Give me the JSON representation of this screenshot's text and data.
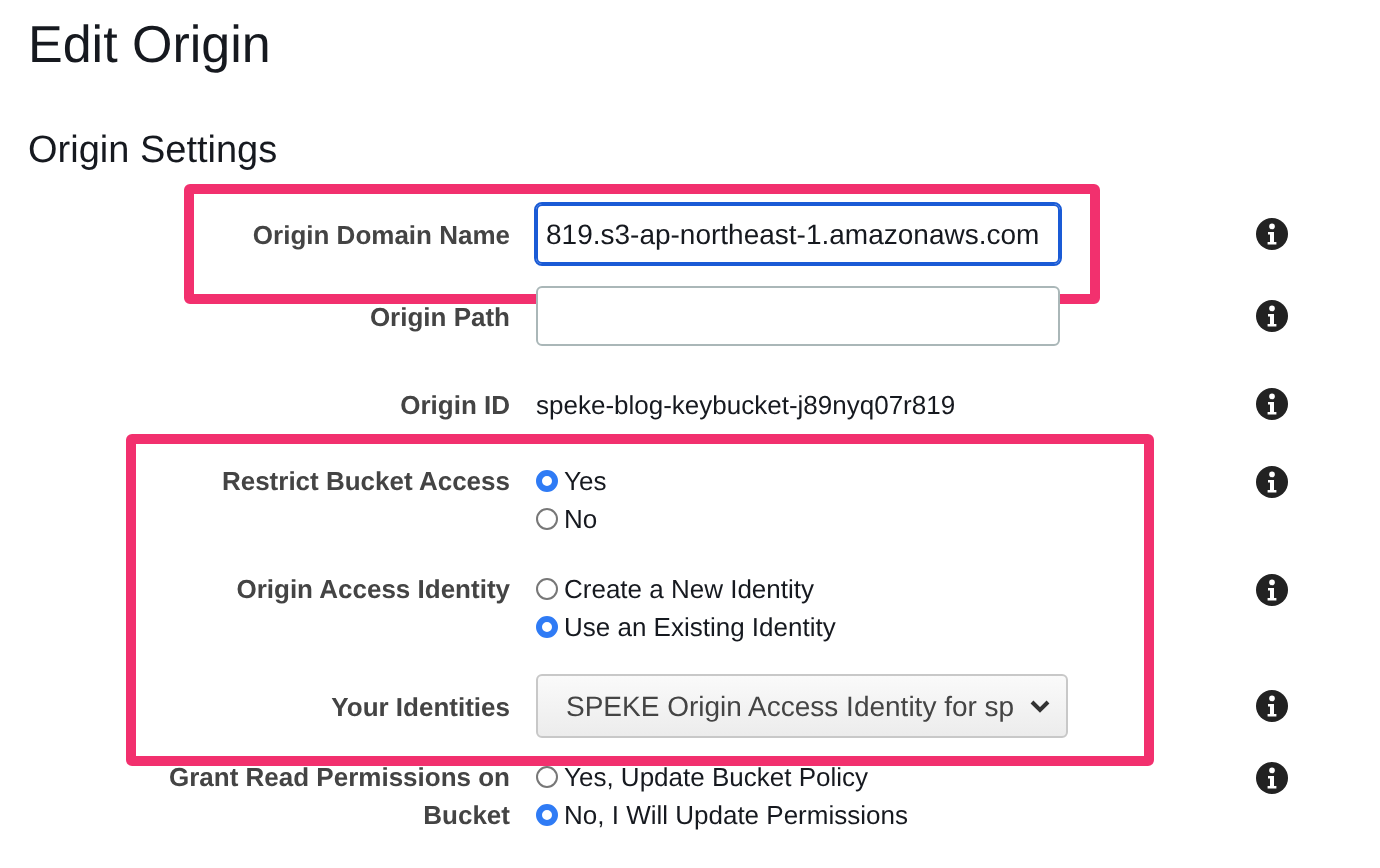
{
  "page": {
    "title": "Edit Origin"
  },
  "section": {
    "title": "Origin Settings"
  },
  "groups": [
    {
      "highlighted": true,
      "rows": [
        {
          "kind": "input",
          "label": "Origin Domain Name",
          "value": "819.s3-ap-northeast-1.amazonaws.com",
          "focused": true
        }
      ]
    },
    {
      "highlighted": false,
      "rows": [
        {
          "kind": "input",
          "label": "Origin Path",
          "focused": false
        },
        {
          "kind": "text",
          "label": "Origin ID",
          "value": "speke-blog-keybucket-j89nyq07r819"
        }
      ]
    },
    {
      "highlighted": true,
      "rows": [
        {
          "kind": "radio",
          "label": "Restrict Bucket Access",
          "options": [
            {
              "label": "Yes",
              "selected": true
            },
            {
              "label": "No",
              "selected": false
            }
          ]
        },
        {
          "kind": "radio",
          "label": "Origin Access Identity",
          "options": [
            {
              "label": "Create a New Identity",
              "selected": false
            },
            {
              "label": "Use an Existing Identity",
              "selected": true
            }
          ]
        },
        {
          "kind": "select",
          "label": "Your Identities",
          "value": "SPEKE Origin Access Identity for sp"
        }
      ]
    },
    {
      "highlighted": false,
      "rows": [
        {
          "kind": "radio",
          "label": "Grant Read Permissions on Bucket",
          "options": [
            {
              "label": "Yes, Update Bucket Policy",
              "selected": false
            },
            {
              "label": "No, I Will Update Permissions",
              "selected": true
            }
          ]
        }
      ]
    }
  ]
}
